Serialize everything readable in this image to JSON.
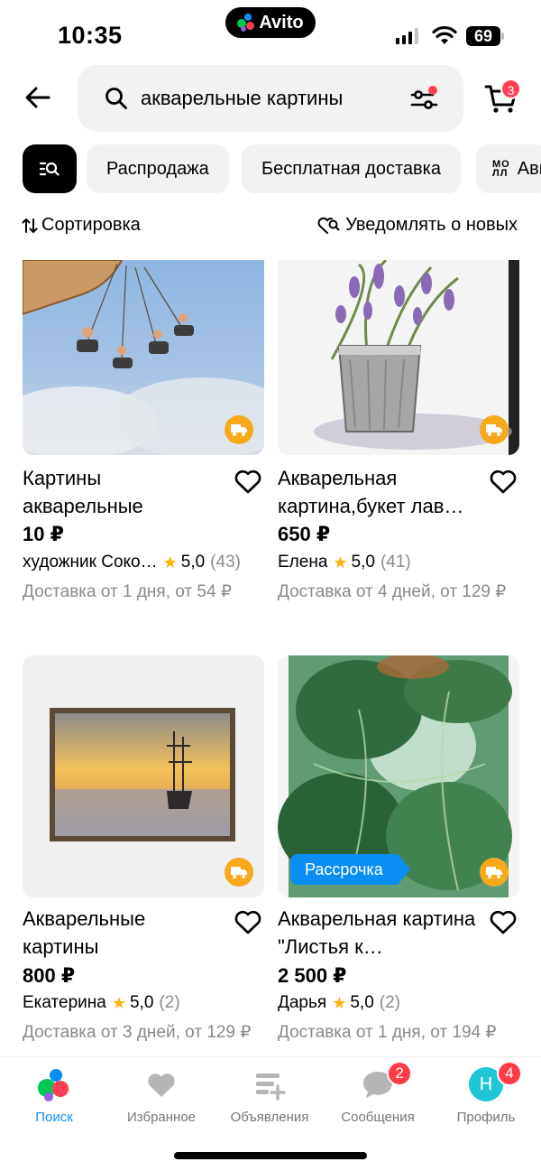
{
  "status_bar": {
    "time": "10:35",
    "island_app": "Avito",
    "battery": "69"
  },
  "search": {
    "query": "акварельные картины",
    "cart_count": "3"
  },
  "chips": [
    {
      "label": ""
    },
    {
      "label": "Распродажа"
    },
    {
      "label": "Бесплатная доставка"
    },
    {
      "label": "Ави",
      "icon": "mall-icon"
    }
  ],
  "sort": {
    "label": "Сортировка"
  },
  "notify": {
    "label": "Уведомлять о новых"
  },
  "listings": [
    {
      "title": "Картины акварельные",
      "price": "10 ₽",
      "seller": "художник Соко…",
      "rating": "5,0",
      "reviews": "(43)",
      "delivery": "Доставка от 1 дня, от 54 ₽"
    },
    {
      "title": "Акварельная картина,букет лав…",
      "price": "650 ₽",
      "seller": "Елена",
      "rating": "5,0",
      "reviews": "(41)",
      "delivery": "Доставка от 4 дней, от 129 ₽"
    },
    {
      "title": "Акварельные картины",
      "price": "800 ₽",
      "seller": "Екатерина",
      "rating": "5,0",
      "reviews": "(2)",
      "delivery": "Доставка от 3 дней, от 129 ₽"
    },
    {
      "title": "Акварельная картина \"Листья к…",
      "price": "2 500 ₽",
      "seller": "Дарья",
      "rating": "5,0",
      "reviews": "(2)",
      "delivery": "Доставка от 1 дня, от 194 ₽",
      "badge": "Рассрочка"
    }
  ],
  "nav": [
    {
      "label": "Поиск"
    },
    {
      "label": "Избранное"
    },
    {
      "label": "Объявления"
    },
    {
      "label": "Сообщения",
      "badge": "2"
    },
    {
      "label": "Профиль",
      "badge": "4",
      "avatar": "Н"
    }
  ],
  "colors": {
    "accent": "#0a8ef4",
    "badge": "#ff3b46",
    "delivery": "#f8a81b",
    "star": "#ffb300"
  }
}
